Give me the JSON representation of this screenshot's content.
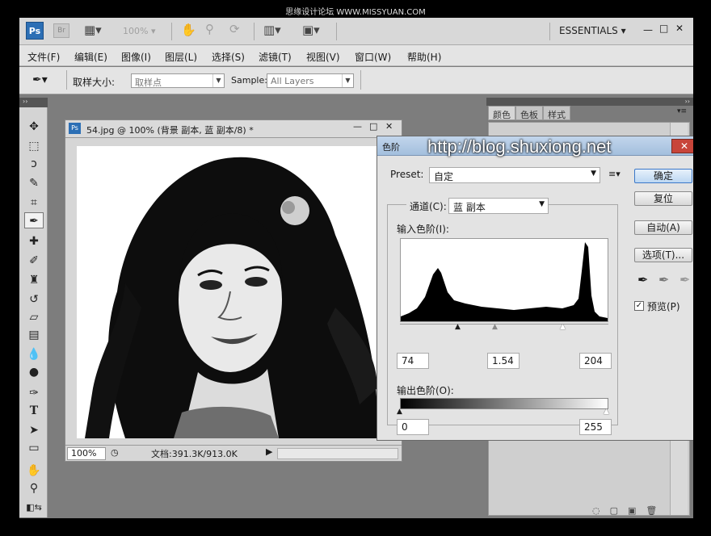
{
  "watermark": {
    "top": "思缘设计论坛 WWW.MISSYUAN.COM"
  },
  "appbar": {
    "ps_logo": "Ps",
    "br_logo": "Br",
    "zoom": "100%",
    "workspace": "ESSENTIALS",
    "window_min": "—",
    "window_max": "□",
    "window_close": "✕"
  },
  "menu": [
    "文件(F)",
    "编辑(E)",
    "图像(I)",
    "图层(L)",
    "选择(S)",
    "滤镜(T)",
    "视图(V)",
    "窗口(W)",
    "帮助(H)"
  ],
  "options": {
    "sample_size_label": "取样大小:",
    "sample_size_value": "取样点",
    "sample_label": "Sample:",
    "sample_value": "All Layers"
  },
  "document": {
    "title": "54.jpg @ 100% (背景 副本, 蓝 副本/8) *",
    "zoom": "100%",
    "doc_info": "文档:391.3K/913.0K"
  },
  "panels": {
    "tabs": [
      "颜色",
      "色板",
      "样式"
    ]
  },
  "levels": {
    "title": "色阶",
    "url_overlay": "http://blog.shuxiong.net",
    "preset_label": "Preset:",
    "preset_value": "自定",
    "channel_label": "通道(C):",
    "channel_value": "蓝 副本",
    "input_label": "输入色阶(I):",
    "input_black": "74",
    "input_gamma": "1.54",
    "input_white": "204",
    "output_label": "输出色阶(O):",
    "output_black": "0",
    "output_white": "255",
    "buttons": {
      "ok": "确定",
      "reset": "复位",
      "auto": "自动(A)",
      "options": "选项(T)..."
    },
    "preview_label": "预览(P)",
    "preview_checked": true
  },
  "colors": {
    "titlebar": "#a3bfdd",
    "close": "#c8453a",
    "ps_blue": "#2c6fb5"
  }
}
